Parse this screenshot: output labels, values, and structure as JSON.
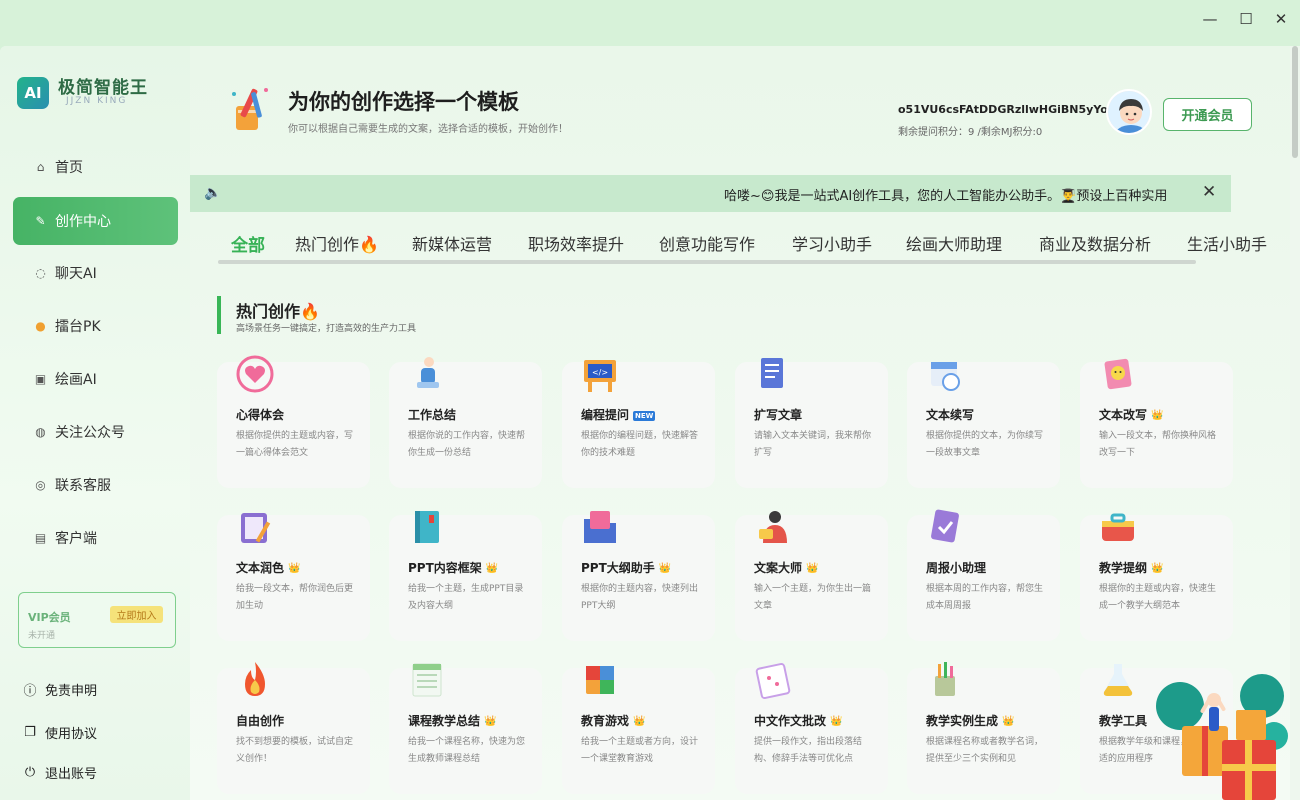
{
  "window": {
    "minimize": "—",
    "maximize": "☐",
    "close": "✕"
  },
  "brand": {
    "logo_text": "AI",
    "name": "极简智能王",
    "sub": "JJZN KING"
  },
  "sidebar": {
    "items": [
      {
        "label": "首页",
        "icon": "home-icon",
        "glyph": "⌂"
      },
      {
        "label": "创作中心",
        "icon": "edit-icon",
        "glyph": "✎"
      },
      {
        "label": "聊天AI",
        "icon": "chat-icon",
        "glyph": "◌"
      },
      {
        "label": "擂台PK",
        "icon": "pk-icon",
        "glyph": "●"
      },
      {
        "label": "绘画AI",
        "icon": "image-icon",
        "glyph": "▣"
      },
      {
        "label": "关注公众号",
        "icon": "wechat-icon",
        "glyph": "◍"
      },
      {
        "label": "联系客服",
        "icon": "location-icon",
        "glyph": "◎"
      },
      {
        "label": "客户端",
        "icon": "printer-icon",
        "glyph": "▤"
      }
    ],
    "vip": {
      "title": "VIP会员",
      "join": "立即加入",
      "status": "未开通"
    },
    "footer": [
      {
        "label": "免责申明",
        "glyph": "ⓘ"
      },
      {
        "label": "使用协议",
        "glyph": "❐"
      },
      {
        "label": "退出账号",
        "glyph": "⏻"
      }
    ]
  },
  "header": {
    "title": "为你的创作选择一个模板",
    "subtitle": "你可以根据自己需要生成的文案，选择合适的模板，开始创作！",
    "username": "o51VU6csFAtDDGRzllwHGiBN5yYo",
    "points": "剩余提问积分：9 /剩余MJ积分:0",
    "member_button": "开通会员"
  },
  "notice": {
    "speaker": "🔈",
    "text": "哈喽~😊我是一站式AI创作工具，您的人工智能办公助手。👨‍🎓预设上百种实用",
    "close": "✕"
  },
  "tabs": [
    "全部",
    "热门创作🔥",
    "新媒体运营",
    "职场效率提升",
    "创意功能写作",
    "学习小助手",
    "绘画大师助理",
    "商业及数据分析",
    "生活小助手"
  ],
  "section": {
    "title": "热门创作🔥",
    "subtitle": "高场景任务一键搞定，打造高效的生产力工具"
  },
  "cards": [
    {
      "title": "心得体会",
      "badge": "",
      "desc": "根据你提供的主题或内容，写一篇心得体会范文",
      "icon": "heart-icon",
      "color": "#f06b9a"
    },
    {
      "title": "工作总结",
      "badge": "",
      "desc": "根据你说的工作内容，快速帮你生成一份总结",
      "icon": "worker-icon",
      "color": "#4a8fd8"
    },
    {
      "title": "编程提问",
      "badge": "NEW",
      "desc": "根据你的编程问题，快速解答你的技术难题",
      "icon": "code-icon",
      "color": "#f3a23a"
    },
    {
      "title": "扩写文章",
      "badge": "",
      "desc": "请输入文本关键词，我来帮你扩写",
      "icon": "document-icon",
      "color": "#5a76d8"
    },
    {
      "title": "文本续写",
      "badge": "",
      "desc": "根据你提供的文本，为你续写一段故事文章",
      "icon": "calendar-icon",
      "color": "#6aa0e8"
    },
    {
      "title": "文本改写",
      "badge": "👑",
      "desc": "输入一段文本，帮你换种风格改写一下",
      "icon": "note-icon",
      "color": "#f28bb0"
    },
    {
      "title": "文本润色",
      "badge": "👑",
      "desc": "给我一段文本，帮你润色后更加生动",
      "icon": "clipboard-icon",
      "color": "#8a6fd1"
    },
    {
      "title": "PPT内容框架",
      "badge": "👑",
      "desc": "给我一个主题，生成PPT目录及内容大纲",
      "icon": "book-icon",
      "color": "#3fb5c8"
    },
    {
      "title": "PPT大纲助手",
      "badge": "👑",
      "desc": "根据你的主题内容，快速列出PPT大纲",
      "icon": "folder-icon",
      "color": "#4a6fd0"
    },
    {
      "title": "文案大师",
      "badge": "👑",
      "desc": "输入一个主题，为你生出一篇文章",
      "icon": "writer-icon",
      "color": "#e4554a"
    },
    {
      "title": "周报小助理",
      "badge": "",
      "desc": "根据本周的工作内容，帮您生成本周周报",
      "icon": "check-doc-icon",
      "color": "#9a7ad8"
    },
    {
      "title": "教学提纲",
      "badge": "👑",
      "desc": "根据你的主题或内容，快速生成一个教学大纲范本",
      "icon": "toolbox-icon",
      "color": "#e8564a"
    },
    {
      "title": "自由创作",
      "badge": "",
      "desc": "找不到想要的模板，试试自定义创作！",
      "icon": "fire-icon",
      "color": "#f0562e"
    },
    {
      "title": "课程教学总结",
      "badge": "👑",
      "desc": "给我一个课程名称，快速为您生成教师课程总结",
      "icon": "sheet-icon",
      "color": "#8fcf8a"
    },
    {
      "title": "教育游戏",
      "badge": "👑",
      "desc": "给我一个主题或者方向，设计一个课堂教育游戏",
      "icon": "cube-icon",
      "color": "#f3a23a"
    },
    {
      "title": "中文作文批改",
      "badge": "👑",
      "desc": "提供一段作文，指出段落结构、修辞手法等可优化点",
      "icon": "essay-icon",
      "color": "#c8a0e8"
    },
    {
      "title": "教学实例生成",
      "badge": "👑",
      "desc": "根据课程名称或者教学名词，提供至少三个实例和见",
      "icon": "pencil-cup-icon",
      "color": "#b8c89a"
    },
    {
      "title": "教学工具",
      "badge": "",
      "desc": "根据教学年级和课程，推荐合适的应用程序",
      "icon": "flask-icon",
      "color": "#f3c23a"
    }
  ]
}
